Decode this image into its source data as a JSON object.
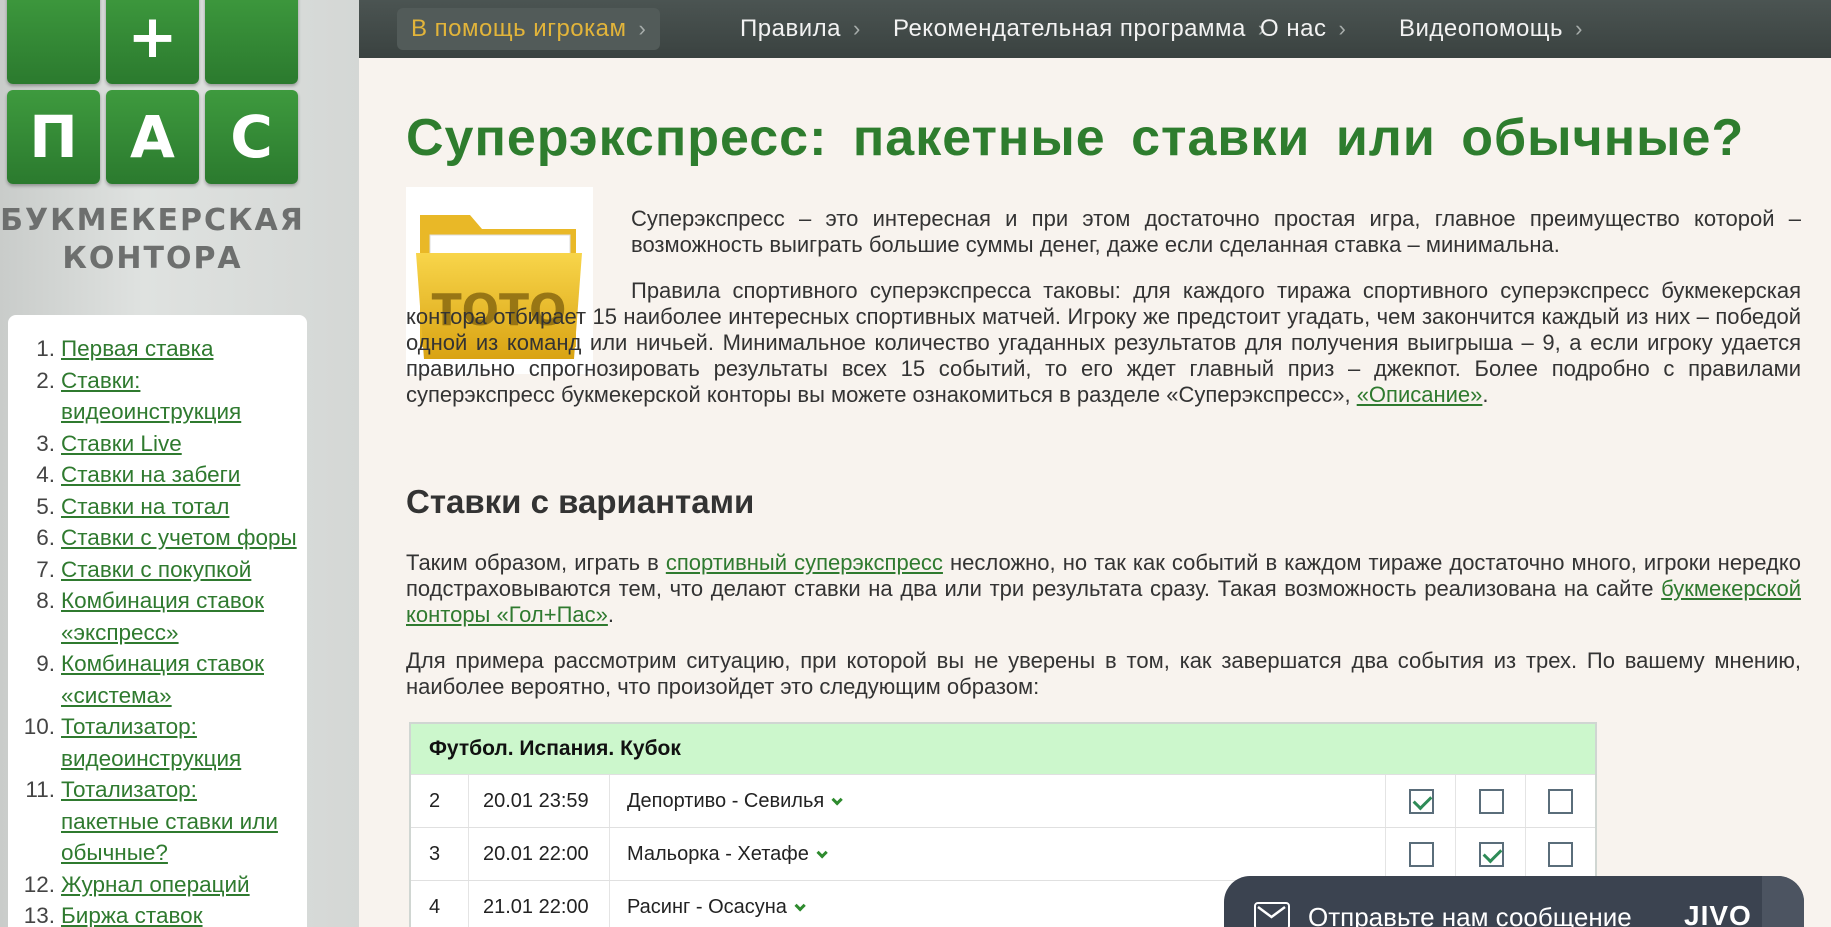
{
  "logo": {
    "plus": "+",
    "letters": [
      "П",
      "А",
      "С"
    ],
    "line1": "БУКМЕКЕРСКАЯ",
    "line2": "КОНТОРА"
  },
  "nav": [
    {
      "label": "В помощь игрокам",
      "active": true
    },
    {
      "label": "Правила"
    },
    {
      "label": "Рекомендательная программа"
    },
    {
      "label": "О нас"
    },
    {
      "label": "Видеопомощь"
    }
  ],
  "sidebar": {
    "items": [
      {
        "num": "1.",
        "label": "Первая ставка"
      },
      {
        "num": "2.",
        "label": "Ставки: видеоинструкция"
      },
      {
        "num": "3.",
        "label": "Ставки Live"
      },
      {
        "num": "4.",
        "label": "Ставки на забеги"
      },
      {
        "num": "5.",
        "label": "Ставки на тотал"
      },
      {
        "num": "6.",
        "label": "Ставки с учетом форы"
      },
      {
        "num": "7.",
        "label": "Ставки с покупкой"
      },
      {
        "num": "8.",
        "label": "Комбинация ставок «экспресс»"
      },
      {
        "num": "9.",
        "label": "Комбинация ставок «система»"
      },
      {
        "num": "10.",
        "label": "Тотализатор: видеоинструкция"
      },
      {
        "num": "11.",
        "label": "Тотализатор: пакетные ставки или обычные?"
      },
      {
        "num": "12.",
        "label": "Журнал операций"
      },
      {
        "num": "13.",
        "label": "Биржа ставок"
      }
    ]
  },
  "article": {
    "title": "Суперэкспресс: пакетные ставки или обычные?",
    "thumb_label": "TOTO",
    "p1": "Суперэкспресс – это интересная и при этом достаточно простая игра, главное преимущество которой – возможность выиграть большие суммы денег, даже если сделанная ставка – минимальна.",
    "p2": "Правила спортивного суперэкспресса таковы: для каждого тиража спортивного суперэкспресс букмекерская контора отбирает 15 наиболее интересных спортивных матчей. Игроку же предстоит угадать, чем закончится каждый из них – победой одной из команд или ничьей. Минимальное количество угаданных результатов для получения выигрыша – 9, а если игроку удается правильно спрогнозировать результаты всех 15 событий, то его ждет главный приз – джекпот. Более подробно с правилами суперэкспресс букмекерской конторы вы можете ознакомиться в разделе «Суперэкспресс», ",
    "p2_link": "«Описание»",
    "p2_end": ".",
    "h2": "Ставки с вариантами",
    "p3_a": "Таким образом, играть в ",
    "p3_link1": "спортивный суперэкспресс",
    "p3_b": " несложно, но так как событий в каждом тираже достаточно много, игроки нередко подстраховываются тем, что делают ставки на два или три результата сразу. Такая возможность реализована на сайте ",
    "p3_link2": "букмекерской конторы «Гол+Пас»",
    "p3_c": ".",
    "p4": "Для примера рассмотрим ситуацию, при которой вы не уверены в том, как завершатся два события из трех. По вашему мнению, наиболее вероятно, что произойдет это следующим образом:"
  },
  "table": {
    "header": "Футбол. Испания. Кубок",
    "rows": [
      {
        "num": "2",
        "date": "20.01 23:59",
        "match": "Депортиво - Севилья",
        "checks": [
          true,
          false,
          false
        ]
      },
      {
        "num": "3",
        "date": "20.01 22:00",
        "match": "Мальорка - Хетафе",
        "checks": [
          false,
          true,
          false
        ]
      },
      {
        "num": "4",
        "date": "21.01 22:00",
        "match": "Расинг - Осасуна",
        "checks": [
          false,
          false,
          false
        ]
      }
    ]
  },
  "chat": {
    "text": "Отправьте нам сообщение",
    "brand": "JIVO"
  }
}
